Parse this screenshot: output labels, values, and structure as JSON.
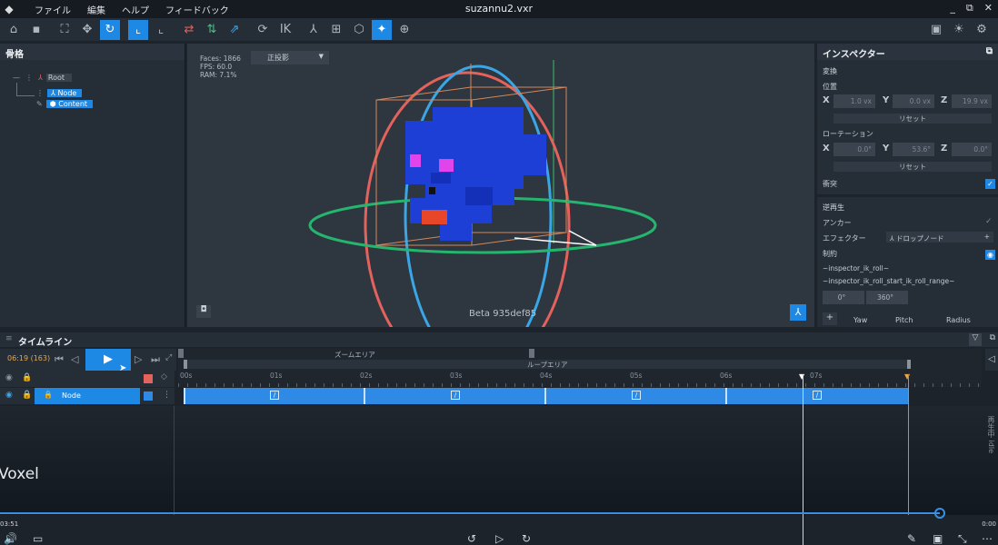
{
  "menubar": {
    "items": [
      "ファイル",
      "編集",
      "ヘルプ",
      "フィードバック"
    ],
    "title": "suzannu2.vxr",
    "controls": [
      "_",
      "⧉",
      "✕"
    ]
  },
  "skeleton": {
    "title": "骨格",
    "root": "Root",
    "node": "Node",
    "content": "Content"
  },
  "viewport": {
    "stats": [
      "Faces: 1866",
      "FPS: 60.0",
      "RAM: 7.1%"
    ],
    "projection": "正投影",
    "version": "Beta 935def85"
  },
  "inspector": {
    "title": "インスペクター",
    "transform_section": "変換",
    "position_label": "位置",
    "position": {
      "x": "1.0 vx",
      "y": "0.0 vx",
      "z": "19.9 vx"
    },
    "reset_label": "リセット",
    "rotation_label": "ローテーション",
    "rotation": {
      "x": "0.0°",
      "y": "53.6°",
      "z": "0.0°"
    },
    "collision_label": "衝突",
    "ik_section": "逆再生",
    "anchor_label": "アンカー",
    "effector_label": "エフェクター",
    "effector_value": "ドロップノード",
    "constraint_label": "制約",
    "ik_roll_1": "~inspector_ik_roll~",
    "ik_roll_2": "~inspector_ik_roll_start_ik_roll_range~",
    "range_min": "0°",
    "range_max": "360°",
    "yaw": "Yaw",
    "pitch": "Pitch",
    "radius": "Radius",
    "plus": "+"
  },
  "timeline": {
    "title": "タイムライン",
    "time": "06:19 (163)",
    "zoom_area": "ズームエリア",
    "loop_area": "ループエリア",
    "ticks": [
      "00s",
      "01s",
      "02s",
      "03s",
      "04s",
      "05s",
      "06s",
      "07s"
    ],
    "layer_name": "Node",
    "side_text": "再生中 idle"
  },
  "video": {
    "title": "Voxel",
    "time_left": "03:51",
    "time_right": "0:00"
  }
}
